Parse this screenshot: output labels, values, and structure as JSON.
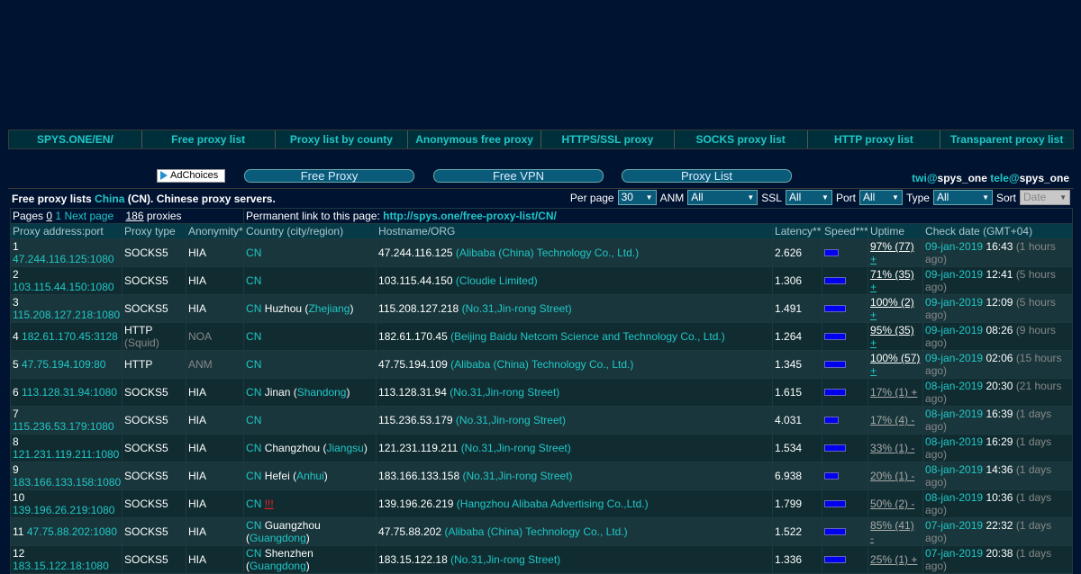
{
  "topnav": [
    "SPYS.ONE/EN/",
    "Free proxy list",
    "Proxy list by county",
    "Anonymous free proxy",
    "HTTPS/SSL proxy",
    "SOCKS proxy list",
    "HTTP proxy list",
    "Transparent proxy list"
  ],
  "promo": {
    "adchoices": "AdChoices",
    "buttons": [
      "Free Proxy",
      "Free VPN",
      "Proxy List"
    ],
    "contact1": "twi@",
    "contact1_handle": "spys_one",
    "contact2": "tele@",
    "contact2_handle": "spys_one"
  },
  "filter": {
    "title_pre": "Free proxy lists ",
    "country": "China",
    "title_post": " (CN). Chinese proxy servers.",
    "per_page_label": "Per page",
    "per_page": "30",
    "anm_label": "ANM",
    "anm": "All",
    "ssl_label": "SSL",
    "ssl": "All",
    "port_label": "Port",
    "port": "All",
    "type_label": "Type",
    "type": "All",
    "sort_label": "Sort",
    "sort": "Date"
  },
  "info": {
    "pages_label": "Pages",
    "page0": "0",
    "page1": "1",
    "next": "Next page",
    "count": "186",
    "count_label": " proxies",
    "perma_label": "Permanent link to this page: ",
    "perma_url": "http://spys.one/free-proxy-list/CN/"
  },
  "headers": [
    "Proxy address:port",
    "Proxy type",
    "Anonymity*",
    "Country (city/region)",
    "Hostname/ORG",
    "Latency**",
    "Speed***",
    "Uptime",
    "Check date (GMT+04)"
  ],
  "rows": [
    {
      "n": "1",
      "addr": "47.244.116.125:1080",
      "type": "SOCKS5",
      "anon": "HIA",
      "cc": "CN",
      "city": "",
      "region": "",
      "host": "47.244.116.125",
      "org": "(Alibaba (China) Technology Co., Ltd.)",
      "lat": "2.626",
      "uptime": "97% (77)",
      "upsign": "+",
      "date": "09-jan-2019",
      "time": "16:43",
      "ago": "(1 hours ago)"
    },
    {
      "n": "2",
      "addr": "103.115.44.150:1080",
      "type": "SOCKS5",
      "anon": "HIA",
      "cc": "CN",
      "city": "",
      "region": "",
      "host": "103.115.44.150",
      "org": "(Cloudie Limited)",
      "lat": "1.306",
      "uptime": "71% (35)",
      "upsign": "+",
      "date": "09-jan-2019",
      "time": "12:41",
      "ago": "(5 hours ago)"
    },
    {
      "n": "3",
      "addr": "115.208.127.218:1080",
      "type": "SOCKS5",
      "anon": "HIA",
      "cc": "CN",
      "city": "Huzhou",
      "region": "Zhejiang",
      "host": "115.208.127.218",
      "org": "(No.31,Jin-rong Street)",
      "lat": "1.491",
      "uptime": "100% (2)",
      "upsign": "+",
      "date": "09-jan-2019",
      "time": "12:09",
      "ago": "(5 hours ago)"
    },
    {
      "n": "4",
      "addr": "182.61.170.45:3128",
      "type": "HTTP",
      "typesub": "(Squid)",
      "anon": "NOA",
      "cc": "CN",
      "city": "",
      "region": "",
      "host": "182.61.170.45",
      "org": "(Beijing Baidu Netcom Science and Technology Co., Ltd.)",
      "lat": "1.264",
      "uptime": "95% (35)",
      "upsign": "+",
      "date": "09-jan-2019",
      "time": "08:26",
      "ago": "(9 hours ago)"
    },
    {
      "n": "5",
      "addr": "47.75.194.109:80",
      "type": "HTTP",
      "anon": "ANM",
      "cc": "CN",
      "city": "",
      "region": "",
      "host": "47.75.194.109",
      "org": "(Alibaba (China) Technology Co., Ltd.)",
      "lat": "1.345",
      "uptime": "100% (57)",
      "upsign": "+",
      "date": "09-jan-2019",
      "time": "02:06",
      "ago": "(15 hours ago)"
    },
    {
      "n": "6",
      "addr": "113.128.31.94:1080",
      "type": "SOCKS5",
      "anon": "HIA",
      "cc": "CN",
      "city": "Jinan",
      "region": "Shandong",
      "host": "113.128.31.94",
      "org": "(No.31,Jin-rong Street)",
      "lat": "1.615",
      "uptime": "17% (1) +",
      "upsign": "",
      "date": "08-jan-2019",
      "time": "20:30",
      "ago": "(21 hours ago)"
    },
    {
      "n": "7",
      "addr": "115.236.53.179:1080",
      "type": "SOCKS5",
      "anon": "HIA",
      "cc": "CN",
      "city": "",
      "region": "",
      "host": "115.236.53.179",
      "org": "(No.31,Jin-rong Street)",
      "lat": "4.031",
      "uptime": "17% (4) -",
      "upsign": "",
      "date": "08-jan-2019",
      "time": "16:39",
      "ago": "(1 days ago)"
    },
    {
      "n": "8",
      "addr": "121.231.119.211:1080",
      "type": "SOCKS5",
      "anon": "HIA",
      "cc": "CN",
      "city": "Changzhou",
      "region": "Jiangsu",
      "host": "121.231.119.211",
      "org": "(No.31,Jin-rong Street)",
      "lat": "1.534",
      "uptime": "33% (1) -",
      "upsign": "",
      "date": "08-jan-2019",
      "time": "16:29",
      "ago": "(1 days ago)"
    },
    {
      "n": "9",
      "addr": "183.166.133.158:1080",
      "type": "SOCKS5",
      "anon": "HIA",
      "cc": "CN",
      "city": "Hefei",
      "region": "Anhui",
      "host": "183.166.133.158",
      "org": "(No.31,Jin-rong Street)",
      "lat": "6.938",
      "uptime": "20% (1) -",
      "upsign": "",
      "date": "08-jan-2019",
      "time": "14:36",
      "ago": "(1 days ago)"
    },
    {
      "n": "10",
      "addr": "139.196.26.219:1080",
      "type": "SOCKS5",
      "anon": "HIA",
      "cc": "CN",
      "city": "",
      "region": "",
      "flag": "!!!",
      "host": "139.196.26.219",
      "org": "(Hangzhou Alibaba Advertising Co.,Ltd.)",
      "lat": "1.799",
      "uptime": "50% (2) -",
      "upsign": "",
      "date": "08-jan-2019",
      "time": "10:36",
      "ago": "(1 days ago)"
    },
    {
      "n": "11",
      "addr": "47.75.88.202:1080",
      "type": "SOCKS5",
      "anon": "HIA",
      "cc": "CN",
      "city": "Guangzhou",
      "region": "Guangdong",
      "host": "47.75.88.202",
      "org": "(Alibaba (China) Technology Co., Ltd.)",
      "lat": "1.522",
      "uptime": "85% (41) -",
      "upsign": "",
      "date": "07-jan-2019",
      "time": "22:32",
      "ago": "(1 days ago)"
    },
    {
      "n": "12",
      "addr": "183.15.122.18:1080",
      "type": "SOCKS5",
      "anon": "HIA",
      "cc": "CN",
      "city": "Shenzhen",
      "region": "Guangdong",
      "host": "183.15.122.18",
      "org": "(No.31,Jin-rong Street)",
      "lat": "1.336",
      "uptime": "25% (1) +",
      "upsign": "",
      "date": "07-jan-2019",
      "time": "20:38",
      "ago": "(1 days ago)"
    }
  ],
  "colors": {
    "bg": "#001331",
    "accent": "#21c7c7",
    "speed_bar": "#0000ee"
  }
}
